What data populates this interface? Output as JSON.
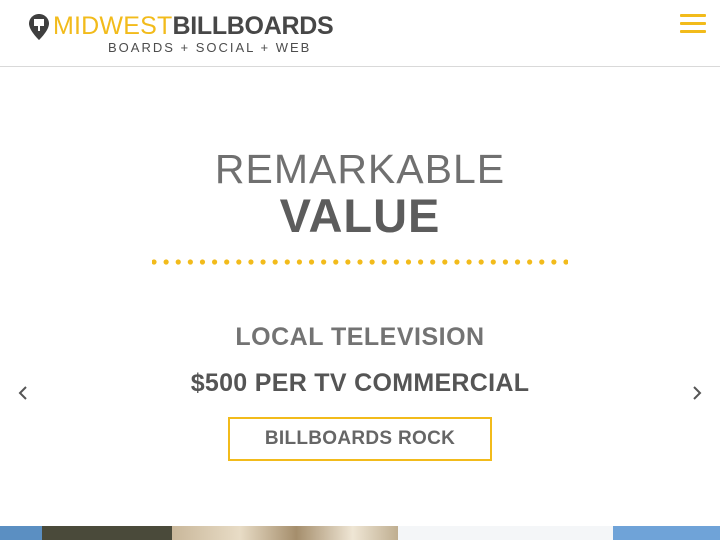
{
  "header": {
    "brand_primary": "MIDWEST",
    "brand_secondary": "BILLBOARDS",
    "tagline": "BOARDS + SOCIAL + WEB",
    "menu_icon": "hamburger-menu-icon"
  },
  "hero": {
    "headline_top": "REMARKABLE",
    "headline_bottom": "VALUE",
    "slide": {
      "label": "LOCAL TELEVISION",
      "price": "$500 PER TV COMMERCIAL",
      "cta_label": "BILLBOARDS ROCK"
    },
    "prev_icon": "chevron-left-icon",
    "next_icon": "chevron-right-icon"
  },
  "colors": {
    "accent": "#f2bb1b",
    "text_dark": "#474747",
    "text_muted": "#707070"
  }
}
